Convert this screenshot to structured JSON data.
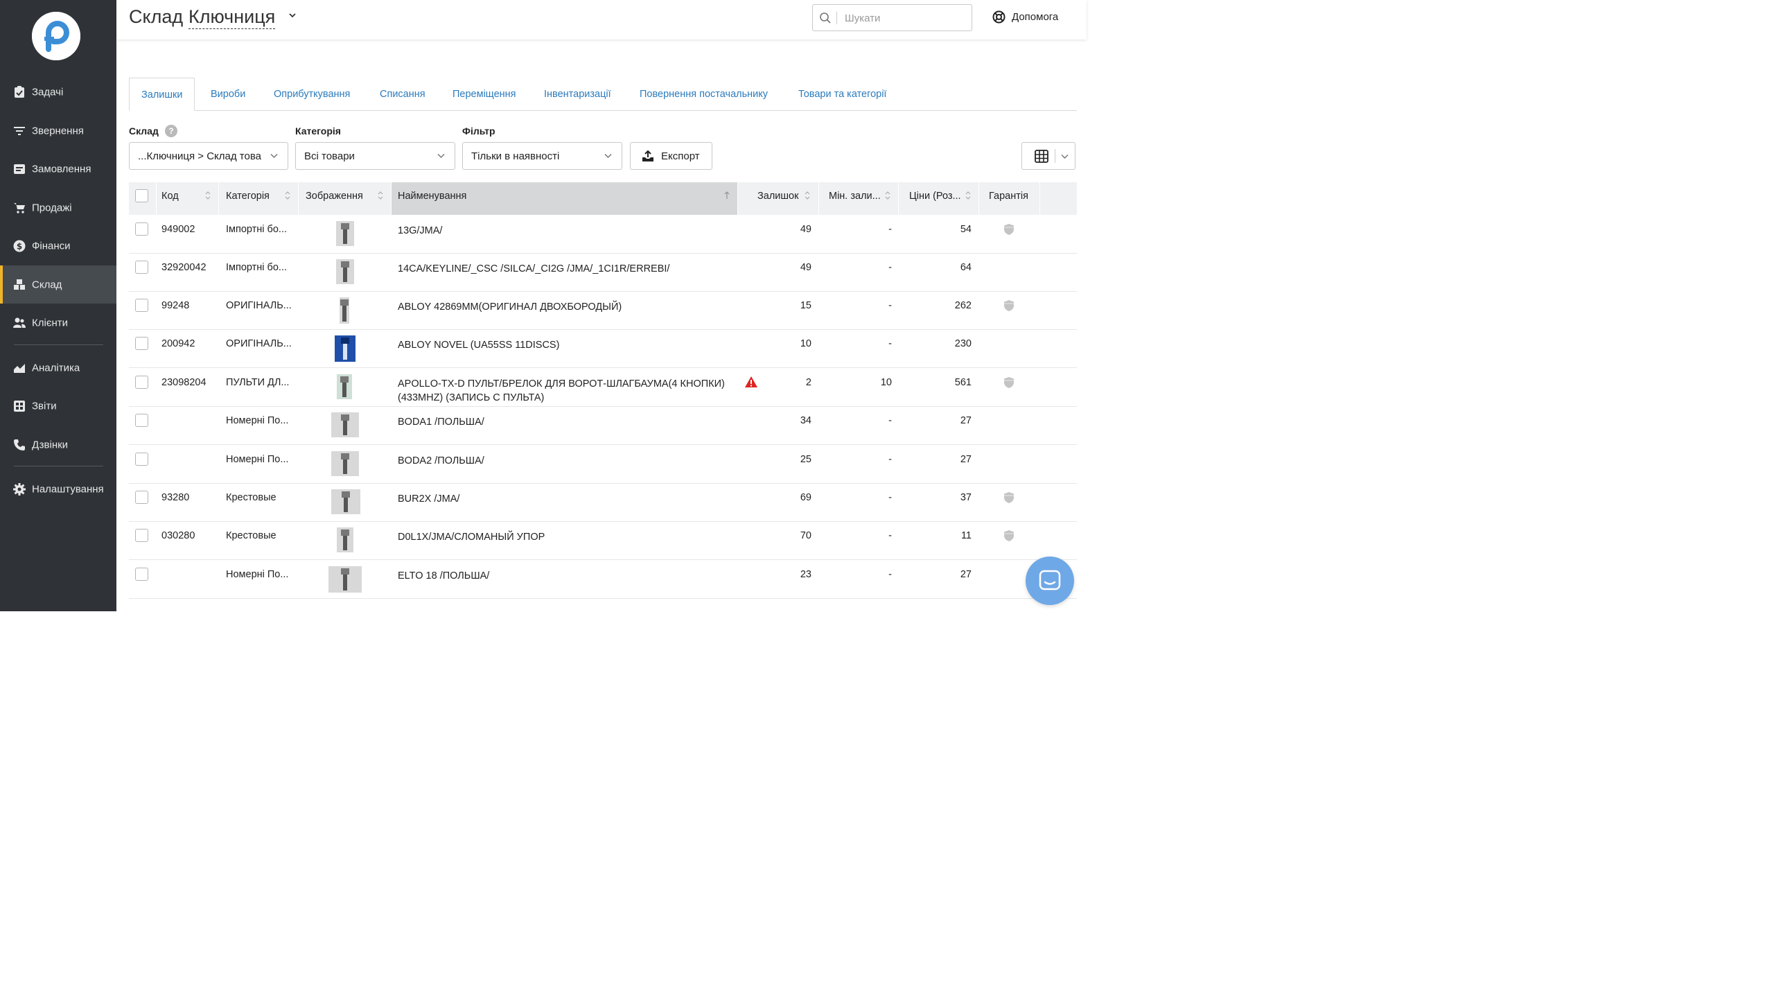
{
  "sidebar": {
    "items": [
      {
        "label": "Задачі",
        "icon": "clipboard-check-icon"
      },
      {
        "label": "Звернення",
        "icon": "filter-lines-icon"
      },
      {
        "label": "Замовлення",
        "icon": "order-list-icon"
      },
      {
        "label": "Продажі",
        "icon": "cart-icon"
      },
      {
        "label": "Фінанси",
        "icon": "dollar-coin-icon"
      },
      {
        "label": "Склад",
        "icon": "boxes-icon",
        "active": true
      },
      {
        "label": "Клієнти",
        "icon": "users-icon"
      },
      {
        "label": "Аналітика",
        "icon": "area-chart-icon"
      },
      {
        "label": "Звіти",
        "icon": "reports-icon"
      },
      {
        "label": "Дзвінки",
        "icon": "phone-icon"
      },
      {
        "label": "Налаштування",
        "icon": "gear-icon"
      }
    ],
    "accent": "#f0b429"
  },
  "header": {
    "title": "Склад",
    "warehouse": "Ключниця",
    "search_placeholder": "Шукати",
    "help_label": "Допомога"
  },
  "tabs": [
    {
      "label": "Залишки",
      "active": true
    },
    {
      "label": "Вироби"
    },
    {
      "label": "Оприбуткування"
    },
    {
      "label": "Списання"
    },
    {
      "label": "Переміщення"
    },
    {
      "label": "Інвентаризації"
    },
    {
      "label": "Повернення постачальнику"
    },
    {
      "label": "Товари та категорії"
    }
  ],
  "filters": {
    "warehouse_label": "Склад",
    "warehouse_value": "...Ключниця > Склад това",
    "category_label": "Категорія",
    "category_value": "Всі товари",
    "filter_label": "Фільтр",
    "filter_value": "Тільки в наявності",
    "export_label": "Експорт"
  },
  "table": {
    "columns": [
      "Код",
      "Категорія",
      "Зображення",
      "Найменування",
      "Залишок",
      "Мін. зали...",
      "Ціни (Роз...",
      "Гарантія"
    ],
    "rows": [
      {
        "code": "949002",
        "category": "Імпортні бо...",
        "name": "13G/JMA/",
        "stock": "49",
        "min": "-",
        "price": "54",
        "warranty": true,
        "warn": false
      },
      {
        "code": "32920042",
        "category": "Імпортні бо...",
        "name": "14CA/KEYLINE/_CSC /SILCA/_CI2G /JMA/_1CI1R/ERREBI/",
        "stock": "49",
        "min": "-",
        "price": "64",
        "warranty": false,
        "warn": false
      },
      {
        "code": "99248",
        "category": "ОРИГІНАЛЬ...",
        "name": "ABLOY 42869MM(ОРИГИНАЛ ДВОХБОРОДЫЙ)",
        "stock": "15",
        "min": "-",
        "price": "262",
        "warranty": true,
        "warn": false
      },
      {
        "code": "200942",
        "category": "ОРИГІНАЛЬ...",
        "name": "ABLOY NOVEL (UA55SS 11DISCS)",
        "stock": "10",
        "min": "-",
        "price": "230",
        "warranty": false,
        "warn": false
      },
      {
        "code": "23098204",
        "category": "ПУЛЬТИ ДЛ...",
        "name": "APOLLO-TX-D ПУЛЬТ/БРЕЛОК ДЛЯ ВОРОТ-ШЛАГБАУМА(4 КНОПКИ) (433MHZ) (ЗАПИСЬ С ПУЛЬТА)",
        "stock": "2",
        "min": "10",
        "price": "561",
        "warranty": true,
        "warn": true
      },
      {
        "code": "",
        "category": "Номерні По...",
        "name": "BODA1 /ПОЛЬША/",
        "stock": "34",
        "min": "-",
        "price": "27",
        "warranty": false,
        "warn": false
      },
      {
        "code": "",
        "category": "Номерні По...",
        "name": "BODA2 /ПОЛЬША/",
        "stock": "25",
        "min": "-",
        "price": "27",
        "warranty": false,
        "warn": false
      },
      {
        "code": "93280",
        "category": "Крестовые",
        "name": "BUR2X /JMA/",
        "stock": "69",
        "min": "-",
        "price": "37",
        "warranty": true,
        "warn": false
      },
      {
        "code": "030280",
        "category": "Крестовые",
        "name": "D0L1X/JMA/СЛОМАНЫЙ УПОР",
        "stock": "70",
        "min": "-",
        "price": "11",
        "warranty": true,
        "warn": false
      },
      {
        "code": "",
        "category": "Номерні По...",
        "name": "ELTO 18 /ПОЛЬША/",
        "stock": "23",
        "min": "-",
        "price": "27",
        "warranty": false,
        "warn": false
      }
    ]
  },
  "colors": {
    "sidebar_bg": "#2f3337",
    "link_blue": "#2b7bbd",
    "warning_red": "#e02424",
    "chat_blue": "#6fa8e6"
  }
}
